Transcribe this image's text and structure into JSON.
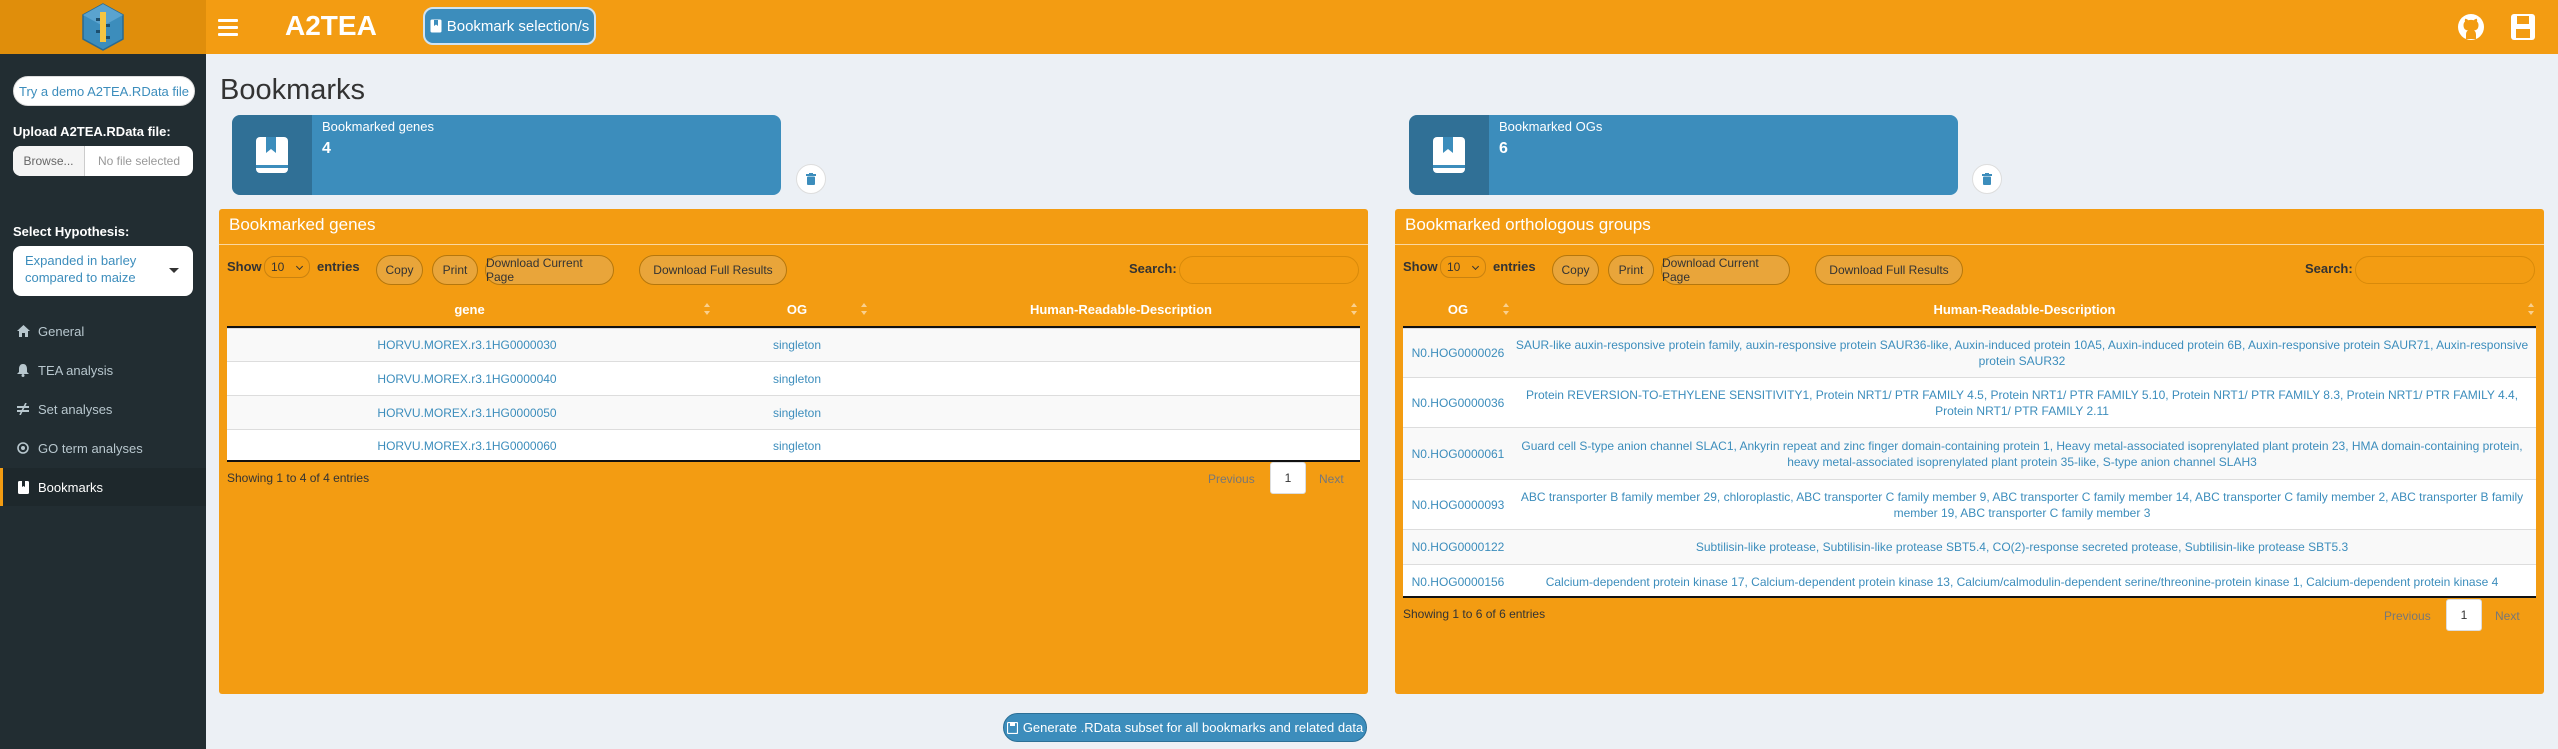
{
  "header": {
    "app_title": "A2TEA",
    "bookmark_button": "Bookmark selection/s"
  },
  "sidebar": {
    "demo_button": "Try a demo A2TEA.RData file",
    "upload_label": "Upload A2TEA.RData file:",
    "browse_button": "Browse...",
    "file_placeholder": "No file selected",
    "hypothesis_label": "Select Hypothesis:",
    "hypothesis_value": "Expanded in barley compared to maize",
    "menu": [
      {
        "label": "General",
        "icon": "home-icon"
      },
      {
        "label": "TEA analysis",
        "icon": "bell-icon"
      },
      {
        "label": "Set analyses",
        "icon": "not-equal-icon"
      },
      {
        "label": "GO term analyses",
        "icon": "circle-icon"
      },
      {
        "label": "Bookmarks",
        "icon": "bookmark-icon"
      }
    ]
  },
  "main": {
    "page_title": "Bookmarks",
    "genes_box": {
      "label": "Bookmarked genes",
      "count": "4"
    },
    "ogs_box": {
      "label": "Bookmarked OGs",
      "count": "6"
    },
    "genes_panel": {
      "title": "Bookmarked genes",
      "show_label": "Show",
      "entries_value": "10",
      "entries_label": "entries",
      "buttons": [
        "Copy",
        "Print",
        "Download Current Page",
        "Download Full Results"
      ],
      "search_label": "Search:",
      "columns": [
        "gene",
        "OG",
        "Human-Readable-Description"
      ],
      "rows": [
        [
          "HORVU.MOREX.r3.1HG0000030",
          "singleton",
          ""
        ],
        [
          "HORVU.MOREX.r3.1HG0000040",
          "singleton",
          ""
        ],
        [
          "HORVU.MOREX.r3.1HG0000050",
          "singleton",
          ""
        ],
        [
          "HORVU.MOREX.r3.1HG0000060",
          "singleton",
          ""
        ]
      ],
      "info": "Showing 1 to 4 of 4 entries",
      "previous": "Previous",
      "page": "1",
      "next": "Next"
    },
    "ogs_panel": {
      "title": "Bookmarked orthologous groups",
      "show_label": "Show",
      "entries_value": "10",
      "entries_label": "entries",
      "buttons": [
        "Copy",
        "Print",
        "Download Current Page",
        "Download Full Results"
      ],
      "search_label": "Search:",
      "columns": [
        "OG",
        "Human-Readable-Description"
      ],
      "rows": [
        [
          "N0.HOG0000026",
          "SAUR-like auxin-responsive protein family, auxin-responsive protein SAUR36-like, Auxin-induced protein 10A5, Auxin-induced protein 6B, Auxin-responsive protein SAUR71, Auxin-responsive protein SAUR32"
        ],
        [
          "N0.HOG0000036",
          "Protein REVERSION-TO-ETHYLENE SENSITIVITY1, Protein NRT1/ PTR FAMILY 4.5, Protein NRT1/ PTR FAMILY 5.10, Protein NRT1/ PTR FAMILY 8.3, Protein NRT1/ PTR FAMILY 4.4, Protein NRT1/ PTR FAMILY 2.11"
        ],
        [
          "N0.HOG0000061",
          "Guard cell S-type anion channel SLAC1, Ankyrin repeat and zinc finger domain-containing protein 1, Heavy metal-associated isoprenylated plant protein 23, HMA domain-containing protein, heavy metal-associated isoprenylated plant protein 35-like, S-type anion channel SLAH3"
        ],
        [
          "N0.HOG0000093",
          "ABC transporter B family member 29, chloroplastic, ABC transporter C family member 9, ABC transporter C family member 14, ABC transporter C family member 2, ABC transporter B family member 19, ABC transporter C family member 3"
        ],
        [
          "N0.HOG0000122",
          "Subtilisin-like protease, Subtilisin-like protease SBT5.4, CO(2)-response secreted protease, Subtilisin-like protease SBT5.3"
        ],
        [
          "N0.HOG0000156",
          "Calcium-dependent protein kinase 17, Calcium-dependent protein kinase 13, Calcium/calmodulin-dependent serine/threonine-protein kinase 1, Calcium-dependent protein kinase 4"
        ]
      ],
      "info": "Showing 1 to 6 of 6 entries",
      "previous": "Previous",
      "page": "1",
      "next": "Next"
    },
    "generate_button": "Generate .RData subset for all bookmarks and related data"
  },
  "colors": {
    "header": "#f39c12",
    "sidebar": "#222d32",
    "primary": "#3c8dbc",
    "panel": "#f39c12",
    "background": "#ecf0f5"
  }
}
